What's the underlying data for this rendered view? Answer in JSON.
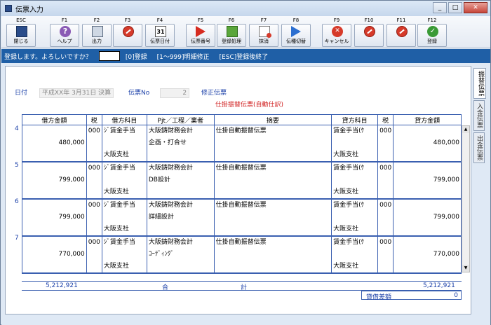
{
  "window": {
    "title": "伝票入力"
  },
  "toolbar": [
    {
      "key": "ESC",
      "label": "閉じる",
      "icon": "exit-icon"
    },
    {
      "key": "F1",
      "label": "ヘルプ",
      "icon": "help-icon"
    },
    {
      "key": "F2",
      "label": "出力",
      "icon": "printer-icon"
    },
    {
      "key": "F3",
      "label": "",
      "icon": "disabled-icon"
    },
    {
      "key": "F4",
      "label": "伝票日付",
      "icon": "calendar-icon"
    },
    {
      "key": "F5",
      "label": "伝票番号",
      "icon": "red-play-icon"
    },
    {
      "key": "F6",
      "label": "登録処理",
      "icon": "book-icon"
    },
    {
      "key": "F7",
      "label": "抹消",
      "icon": "delete-doc-icon"
    },
    {
      "key": "F8",
      "label": "伝種切替",
      "icon": "blue-play-icon"
    },
    {
      "key": "F9",
      "label": "キャンセル",
      "icon": "cancel-icon"
    },
    {
      "key": "F10",
      "label": "",
      "icon": "disabled-icon"
    },
    {
      "key": "F11",
      "label": "",
      "icon": "disabled-icon"
    },
    {
      "key": "F12",
      "label": "登録",
      "icon": "ok-icon"
    }
  ],
  "message": {
    "prompt": "登録します。よろしいですか？",
    "input": "",
    "hint1": "[0]登録",
    "hint2": "[1～999]明細修正",
    "hint3": "[ESC]登録後終了"
  },
  "tabs": [
    "振替伝票",
    "入金伝票",
    "出金伝票"
  ],
  "header": {
    "date_label": "日付",
    "date_value": "平成XX年 3月31日 決算",
    "no_label": "伝票No",
    "no_value": "2",
    "mode": "修正伝票",
    "type": "仕掛振替伝票(自動仕訳)"
  },
  "columns": [
    "借方金額",
    "税",
    "借方科目",
    "Pjt／工程／業者",
    "摘要",
    "貸方科目",
    "税",
    "貸方金額"
  ],
  "rows": [
    {
      "no": "4",
      "debit_amount": "480,000",
      "debit_tax": "000",
      "debit_account": "ｼﾞ賃金手当",
      "debit_dept": "大阪支社",
      "pjt": "大阪鋳財務会計",
      "process": "企画・打合せ",
      "memo": "仕掛自動振替伝票",
      "credit_account": "賃金手当(ｹ",
      "credit_dept": "大阪支社",
      "credit_tax": "000",
      "credit_amount": "480,000"
    },
    {
      "no": "5",
      "debit_amount": "799,000",
      "debit_tax": "000",
      "debit_account": "ｼﾞ賃金手当",
      "debit_dept": "大阪支社",
      "pjt": "大阪鋳財務会計",
      "process": "DB設計",
      "memo": "仕掛自動振替伝票",
      "credit_account": "賃金手当(ｹ",
      "credit_dept": "大阪支社",
      "credit_tax": "000",
      "credit_amount": "799,000"
    },
    {
      "no": "6",
      "debit_amount": "799,000",
      "debit_tax": "000",
      "debit_account": "ｼﾞ賃金手当",
      "debit_dept": "大阪支社",
      "pjt": "大阪鋳財務会計",
      "process": "詳細設計",
      "memo": "仕掛自動振替伝票",
      "credit_account": "賃金手当(ｹ",
      "credit_dept": "大阪支社",
      "credit_tax": "000",
      "credit_amount": "799,000"
    },
    {
      "no": "7",
      "debit_amount": "770,000",
      "debit_tax": "000",
      "debit_account": "ｼﾞ賃金手当",
      "debit_dept": "大阪支社",
      "pjt": "大阪鋳財務会計",
      "process": "ｺｰﾃﾞｨﾝｸﾞ",
      "memo": "仕掛自動振替伝票",
      "credit_account": "賃金手当(ｹ",
      "credit_dept": "大阪支社",
      "credit_tax": "000",
      "credit_amount": "770,000"
    }
  ],
  "totals": {
    "debit": "5,212,921",
    "label_a": "合",
    "label_b": "計",
    "credit": "5,212,921"
  },
  "difference": {
    "label": "貸借差額",
    "value": "0"
  }
}
